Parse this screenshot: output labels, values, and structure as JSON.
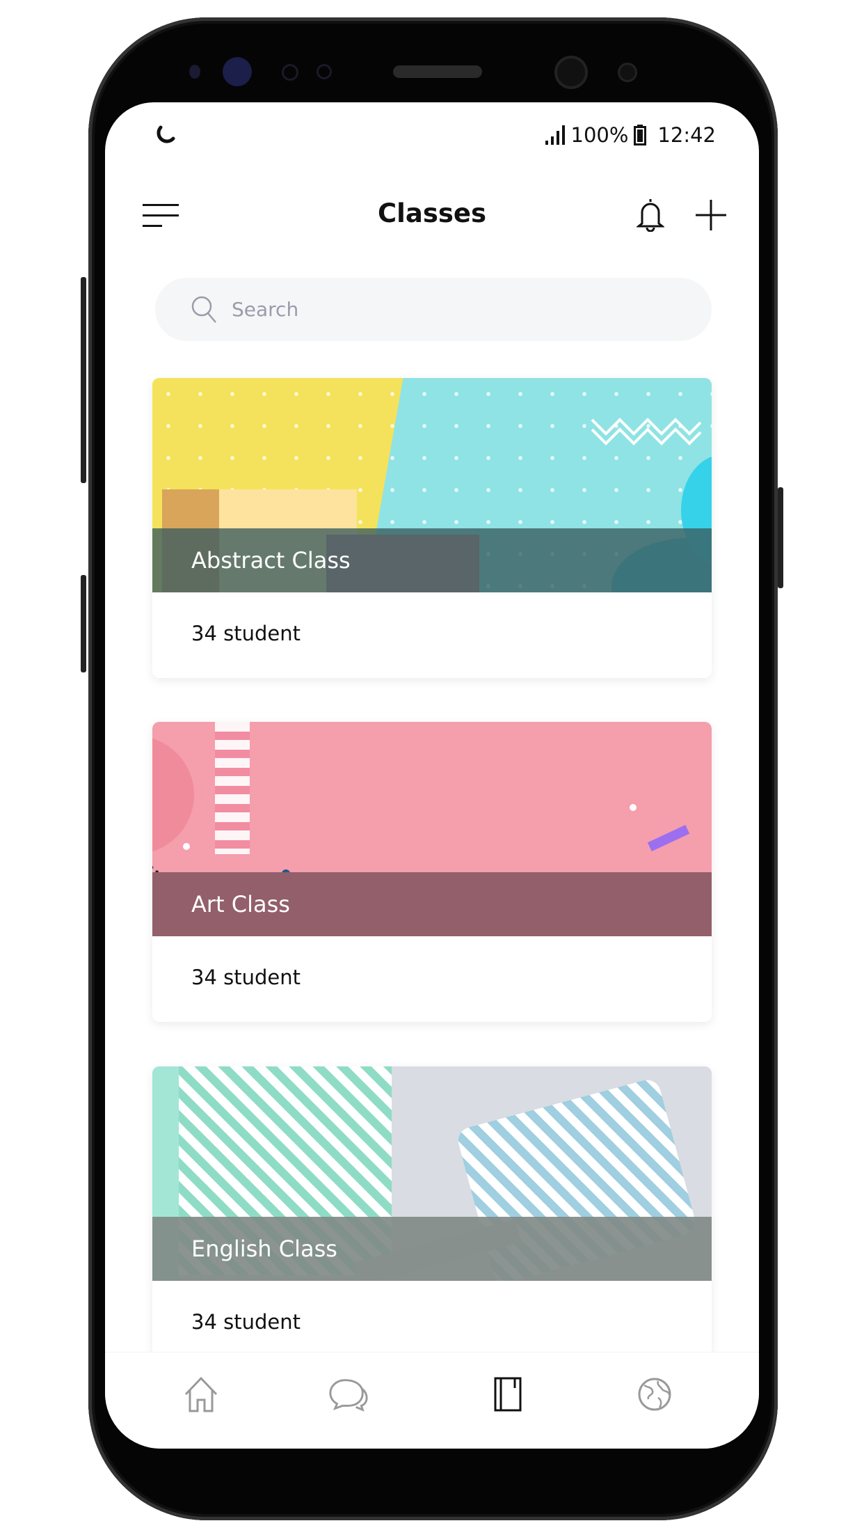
{
  "status_bar": {
    "battery": "100%",
    "time": "12:42",
    "icons": [
      "sync-icon",
      "signal-icon",
      "battery-icon"
    ]
  },
  "header": {
    "title": "Classes",
    "icons": [
      "menu-icon",
      "bell-icon",
      "plus-icon"
    ]
  },
  "search": {
    "placeholder": "Search"
  },
  "classes": [
    {
      "name": "Abstract Class",
      "students": "34 student",
      "overlay_color": "#4a6e70"
    },
    {
      "name": "Art Class",
      "students": "34 student",
      "overlay_color": "#925f6b"
    },
    {
      "name": "English Class",
      "students": "34 student",
      "overlay_color": "#8a918e"
    }
  ],
  "bottom_nav": {
    "items": [
      {
        "icon": "home-icon",
        "active": false
      },
      {
        "icon": "chat-icon",
        "active": false
      },
      {
        "icon": "book-icon",
        "active": true
      },
      {
        "icon": "globe-icon",
        "active": false
      }
    ]
  }
}
